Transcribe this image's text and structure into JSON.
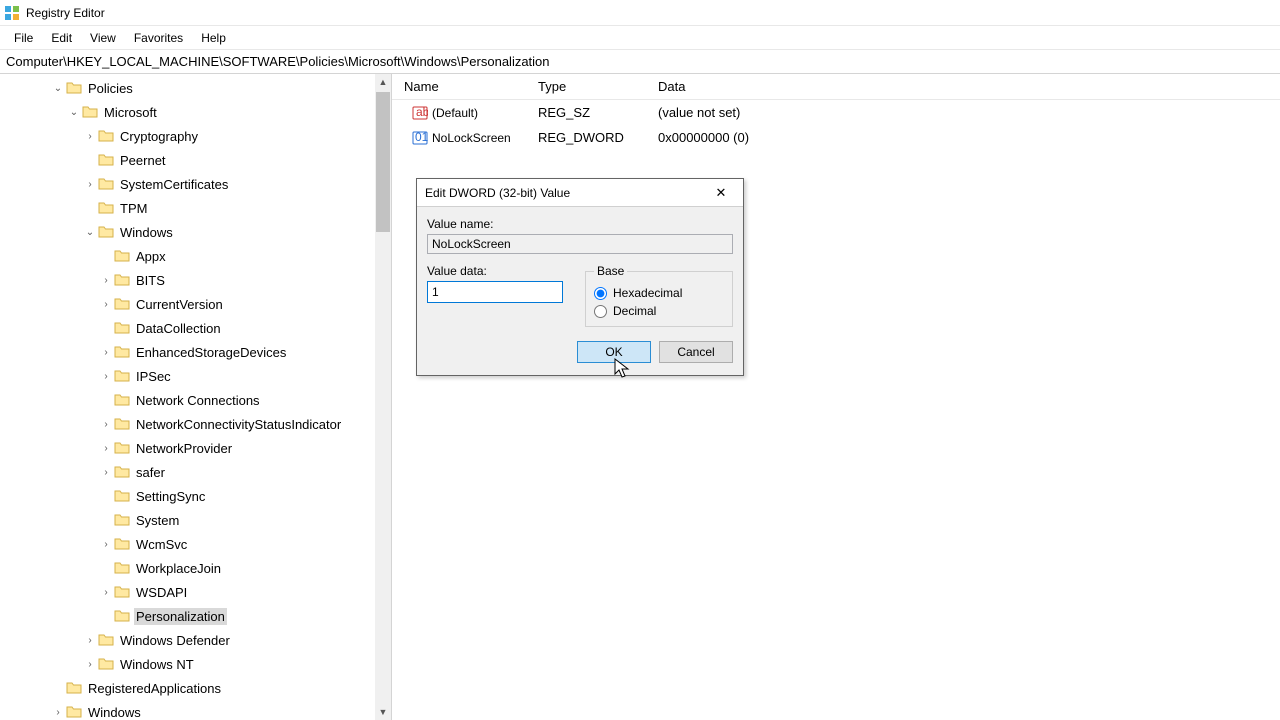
{
  "app": {
    "title": "Registry Editor"
  },
  "menu": {
    "file": "File",
    "edit": "Edit",
    "view": "View",
    "favorites": "Favorites",
    "help": "Help"
  },
  "address": "Computer\\HKEY_LOCAL_MACHINE\\SOFTWARE\\Policies\\Microsoft\\Windows\\Personalization",
  "tree": {
    "policies": "Policies",
    "microsoft": "Microsoft",
    "cryptography": "Cryptography",
    "peernet": "Peernet",
    "systemcertificates": "SystemCertificates",
    "tpm": "TPM",
    "windows": "Windows",
    "appx": "Appx",
    "bits": "BITS",
    "currentversion": "CurrentVersion",
    "datacollection": "DataCollection",
    "enhancedstoragedevices": "EnhancedStorageDevices",
    "ipsec": "IPSec",
    "networkconnections": "Network Connections",
    "networkconnectivity": "NetworkConnectivityStatusIndicator",
    "networkprovider": "NetworkProvider",
    "safer": "safer",
    "settingsync": "SettingSync",
    "system": "System",
    "wcmsvc": "WcmSvc",
    "workplacejoin": "WorkplaceJoin",
    "wsdapi": "WSDAPI",
    "personalization": "Personalization",
    "windowsdefender": "Windows Defender",
    "windowsnt": "Windows NT",
    "registeredapps": "RegisteredApplications",
    "windows2": "Windows"
  },
  "list": {
    "headerName": "Name",
    "headerType": "Type",
    "headerData": "Data",
    "rows": [
      {
        "name": "(Default)",
        "type": "REG_SZ",
        "data": "(value not set)"
      },
      {
        "name": "NoLockScreen",
        "type": "REG_DWORD",
        "data": "0x00000000 (0)"
      }
    ]
  },
  "dialog": {
    "title": "Edit DWORD (32-bit) Value",
    "valueNameLabel": "Value name:",
    "valueName": "NoLockScreen",
    "valueDataLabel": "Value data:",
    "valueData": "1",
    "baseLabel": "Base",
    "hex": "Hexadecimal",
    "dec": "Decimal",
    "ok": "OK",
    "cancel": "Cancel"
  }
}
